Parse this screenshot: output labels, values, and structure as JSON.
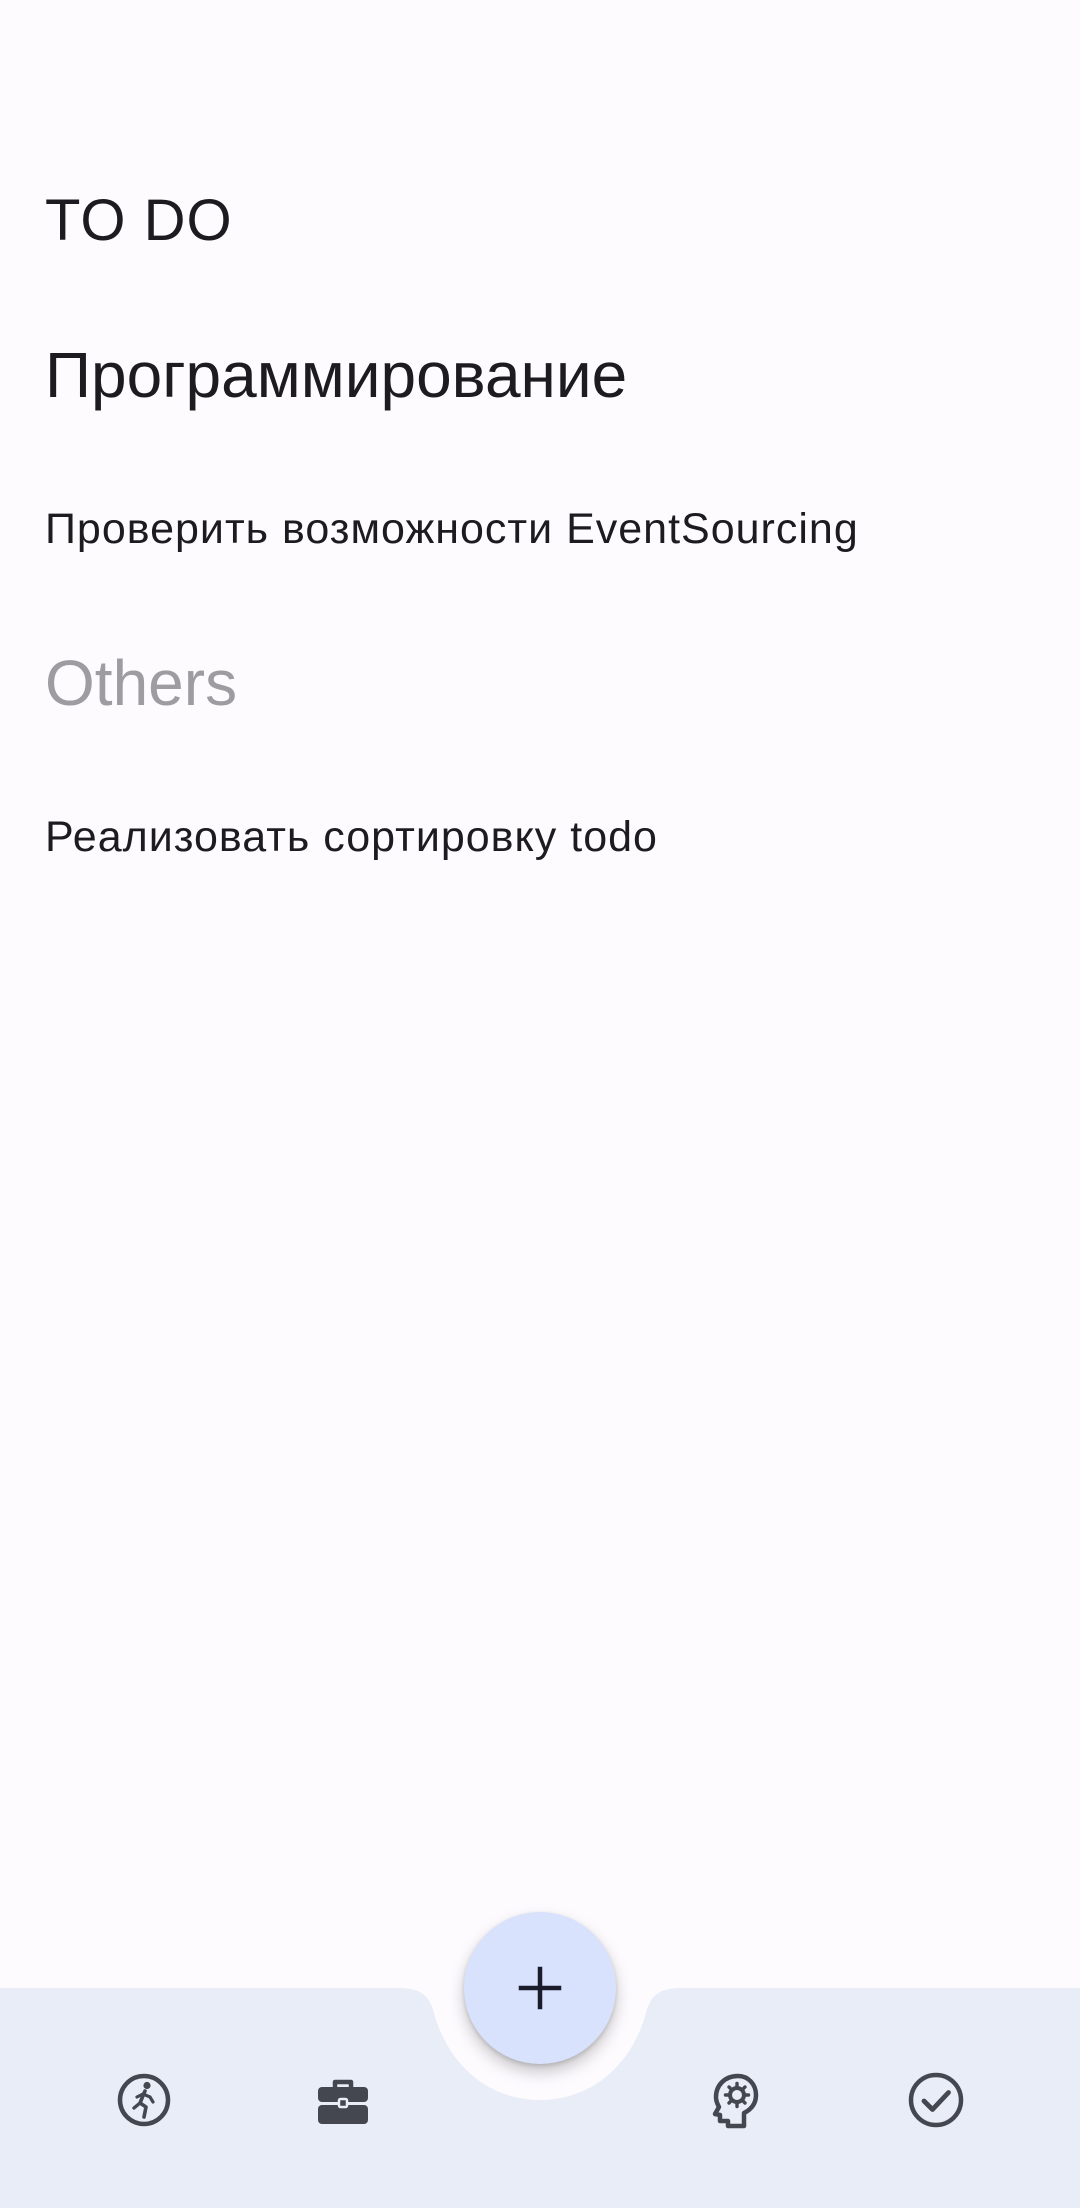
{
  "header": {
    "title": "TO DO"
  },
  "groups": [
    {
      "title": "Программирование",
      "items": [
        "Проверить возможности EventSourcing"
      ]
    },
    {
      "title": "Others",
      "items": [
        "Реализовать сортировку todo"
      ]
    }
  ],
  "bottom_nav": {
    "items": [
      {
        "icon": "running-person-icon"
      },
      {
        "icon": "briefcase-icon"
      },
      {
        "icon": "head-gear-icon"
      },
      {
        "icon": "check-circle-icon"
      }
    ],
    "fab_icon": "plus-icon"
  },
  "colors": {
    "background": "#fdfbfe",
    "nav_background": "#e9edf8",
    "fab_background": "#d9e2fd",
    "muted_group_title": "#9e9ca0",
    "icon": "#44474f"
  }
}
